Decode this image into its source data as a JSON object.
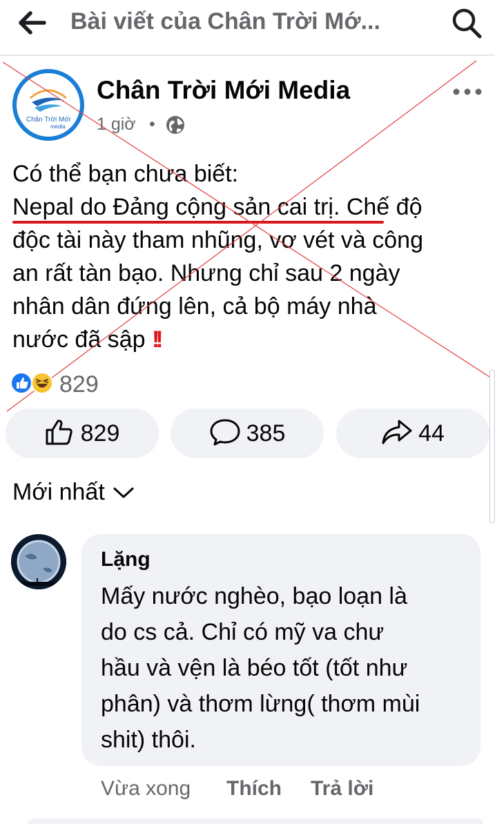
{
  "header": {
    "title": "Bài viết của Chân Trời Mớ...",
    "back_icon": "arrow-left-icon",
    "search_icon": "search-icon"
  },
  "post": {
    "page_name": "Chân Trời Mới Media",
    "avatar_text": "Chân Trời Mới",
    "avatar_subtext": "media",
    "time": "1 giờ",
    "dot": "•",
    "privacy_icon": "globe-icon",
    "text_lines": [
      "Có thể bạn chưa biết:",
      "Nepal do Đảng cộng sản cai trị. Chế độ",
      "độc tài này tham nhũng, vơ vét và công",
      "an rất tàn bạo. Nhưng chỉ sau 2 ngày",
      "nhân dân đứng lên, cả bộ máy nhà",
      "nước đã sập"
    ],
    "emphasis": "!!",
    "reaction_count": "829"
  },
  "actions": {
    "like": "829",
    "comment": "385",
    "share": "44"
  },
  "sort": {
    "label": "Mới nhất"
  },
  "comment": {
    "author": "Lặng",
    "lines": [
      "Mấy nước nghèo, bạo loạn là",
      "do cs cả. Chỉ có mỹ va chư",
      "hầu và vện là béo tốt (tốt như",
      "phân) và thơm lừng( thơm mùi",
      "shit) thôi."
    ],
    "time": "Vừa xong",
    "like_label": "Thích",
    "reply_label": "Trả lời"
  },
  "colors": {
    "accent_blue": "#1877f2",
    "secondary_text": "#65676b",
    "bubble_bg": "#f0f2f5",
    "underline_red": "#d9141b"
  }
}
